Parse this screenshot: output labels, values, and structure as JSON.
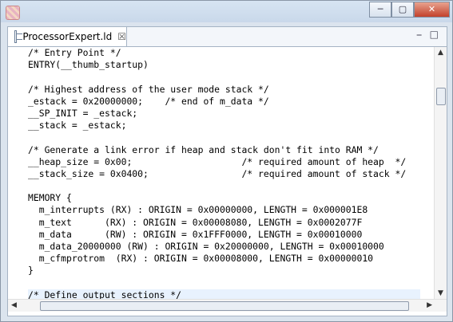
{
  "window": {
    "minimize_label": "─",
    "maximize_label": "▢",
    "close_label": "✕"
  },
  "tab": {
    "label": "ProcessorExpert.ld",
    "close_label": "☒"
  },
  "panel": {
    "minimize_label": "⎯",
    "maximize_label": "□"
  },
  "code": {
    "lines": [
      "/* Entry Point */",
      "ENTRY(__thumb_startup)",
      "",
      "/* Highest address of the user mode stack */",
      "_estack = 0x20000000;    /* end of m_data */",
      "__SP_INIT = _estack;",
      "__stack = _estack;",
      "",
      "/* Generate a link error if heap and stack don't fit into RAM */",
      "__heap_size = 0x00;                    /* required amount of heap  */",
      "__stack_size = 0x0400;                 /* required amount of stack */",
      "",
      "MEMORY {",
      "  m_interrupts (RX) : ORIGIN = 0x00000000, LENGTH = 0x000001E8",
      "  m_text      (RX) : ORIGIN = 0x00008080, LENGTH = 0x0002077F",
      "  m_data      (RW) : ORIGIN = 0x1FFF0000, LENGTH = 0x00010000",
      "  m_data_20000000 (RW) : ORIGIN = 0x20000000, LENGTH = 0x00010000",
      "  m_cfmprotrom  (RX) : ORIGIN = 0x00008000, LENGTH = 0x00000010",
      "}",
      "",
      "/* Define output sections */"
    ]
  }
}
